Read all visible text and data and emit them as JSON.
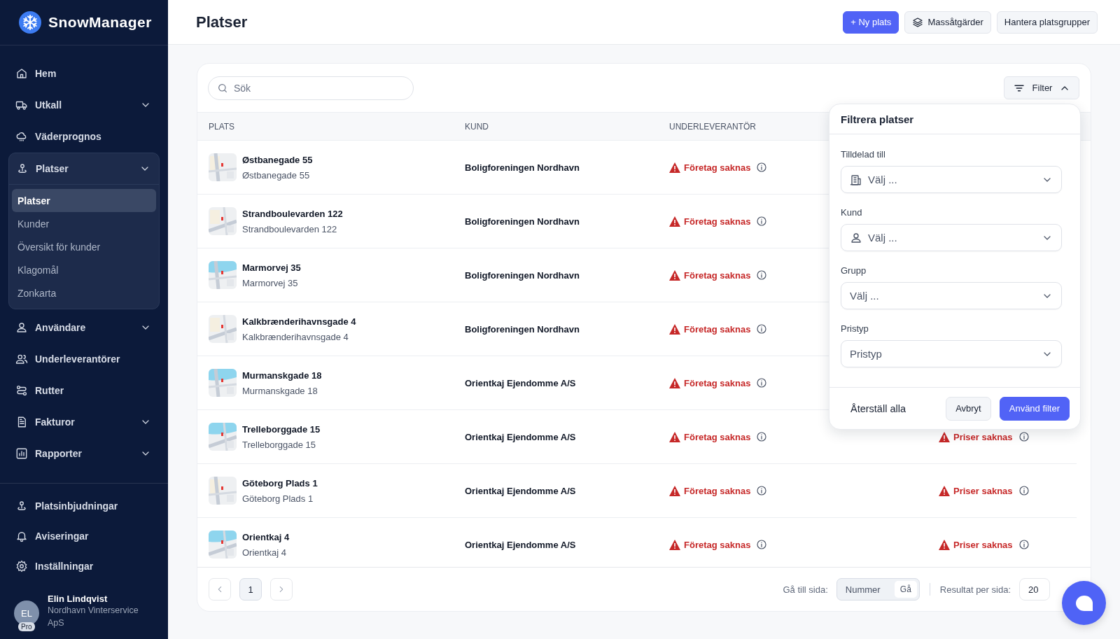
{
  "brand": {
    "name": "SnowManager"
  },
  "sidebar": {
    "items": [
      {
        "label": "Hem"
      },
      {
        "label": "Utkall",
        "expanded": false
      },
      {
        "label": "Väderprognos"
      },
      {
        "label": "Platser",
        "expanded": true,
        "children": [
          {
            "label": "Platser",
            "selected": true
          },
          {
            "label": "Kunder",
            "selected": false
          },
          {
            "label": "Översikt för kunder",
            "selected": false
          },
          {
            "label": "Klagomål",
            "selected": false
          },
          {
            "label": "Zonkarta",
            "selected": false
          }
        ]
      },
      {
        "label": "Användare",
        "expanded": false
      },
      {
        "label": "Underleverantörer"
      },
      {
        "label": "Rutter"
      },
      {
        "label": "Fakturor",
        "expanded": false
      },
      {
        "label": "Rapporter",
        "expanded": false
      }
    ],
    "bottom_items": [
      {
        "label": "Platsinbjudningar"
      },
      {
        "label": "Aviseringar"
      },
      {
        "label": "Inställningar"
      }
    ],
    "user": {
      "initials": "EL",
      "badge": "Pro",
      "name": "Elin Lindqvist",
      "company": "Nordhavn Vinterservice ApS"
    }
  },
  "header": {
    "title": "Platser",
    "buttons": [
      {
        "label": "+ Ny plats",
        "kind": "primary"
      },
      {
        "label": "Massåtgärder",
        "kind": "layers"
      },
      {
        "label": "Hantera platsgrupper",
        "kind": "plain"
      }
    ]
  },
  "search": {
    "placeholder": "Sök"
  },
  "filter_button": {
    "label": "Filter",
    "expanded": true
  },
  "table": {
    "columns": [
      "PLATS",
      "KUND",
      "UNDERLEVERANTÖR"
    ],
    "rows": [
      {
        "name": "Østbanegade 55",
        "address": "Østbanegade 55",
        "customer": "Boligforeningen Nordhavn",
        "subcontractor": "Företag saknas"
      },
      {
        "name": "Strandboulevarden 122",
        "address": "Strandboulevarden 122",
        "customer": "Boligforeningen Nordhavn",
        "subcontractor": "Företag saknas"
      },
      {
        "name": "Marmorvej 35",
        "address": "Marmorvej 35",
        "customer": "Boligforeningen Nordhavn",
        "subcontractor": "Företag saknas"
      },
      {
        "name": "Kalkbrænderihavnsgade 4",
        "address": "Kalkbrænderihavnsgade 4",
        "customer": "Boligforeningen Nordhavn",
        "subcontractor": "Företag saknas"
      },
      {
        "name": "Murmanskgade 18",
        "address": "Murmanskgade 18",
        "customer": "Orientkaj Ejendomme A/S",
        "subcontractor": "Företag saknas"
      },
      {
        "name": "Trelleborggade 15",
        "address": "Trelleborggade 15",
        "customer": "Orientkaj Ejendomme A/S",
        "subcontractor": "Företag saknas",
        "price": "Priser saknas"
      },
      {
        "name": "Göteborg Plads 1",
        "address": "Göteborg Plads 1",
        "customer": "Orientkaj Ejendomme A/S",
        "subcontractor": "Företag saknas",
        "price": "Priser saknas"
      },
      {
        "name": "Orientkaj 4",
        "address": "Orientkaj 4",
        "customer": "Orientkaj Ejendomme A/S",
        "subcontractor": "Företag saknas",
        "price": "Priser saknas"
      }
    ]
  },
  "filter_panel": {
    "title": "Filtrera platser",
    "fields": [
      {
        "label": "Tilldelad till",
        "placeholder": "Välj ...",
        "kind": "building"
      },
      {
        "label": "Kund",
        "placeholder": "Välj ...",
        "kind": "person"
      },
      {
        "label": "Grupp",
        "placeholder": "Välj ...",
        "kind": "plain"
      },
      {
        "label": "Pristyp",
        "placeholder": "Pristyp",
        "kind": "plain"
      }
    ],
    "buttons": [
      {
        "label": "Återställ alla",
        "kind": "ghost"
      },
      {
        "label": "Avbryt",
        "kind": "secondary"
      },
      {
        "label": "Använd filter",
        "kind": "primary"
      }
    ]
  },
  "pagination": {
    "pages": [
      {
        "label": "1",
        "selected": true
      }
    ],
    "goto_label": "Gå till sida:",
    "goto_placeholder": "Nummer",
    "goto_button": "Gå",
    "per_page_label": "Resultat per sida:",
    "per_page": "20"
  }
}
